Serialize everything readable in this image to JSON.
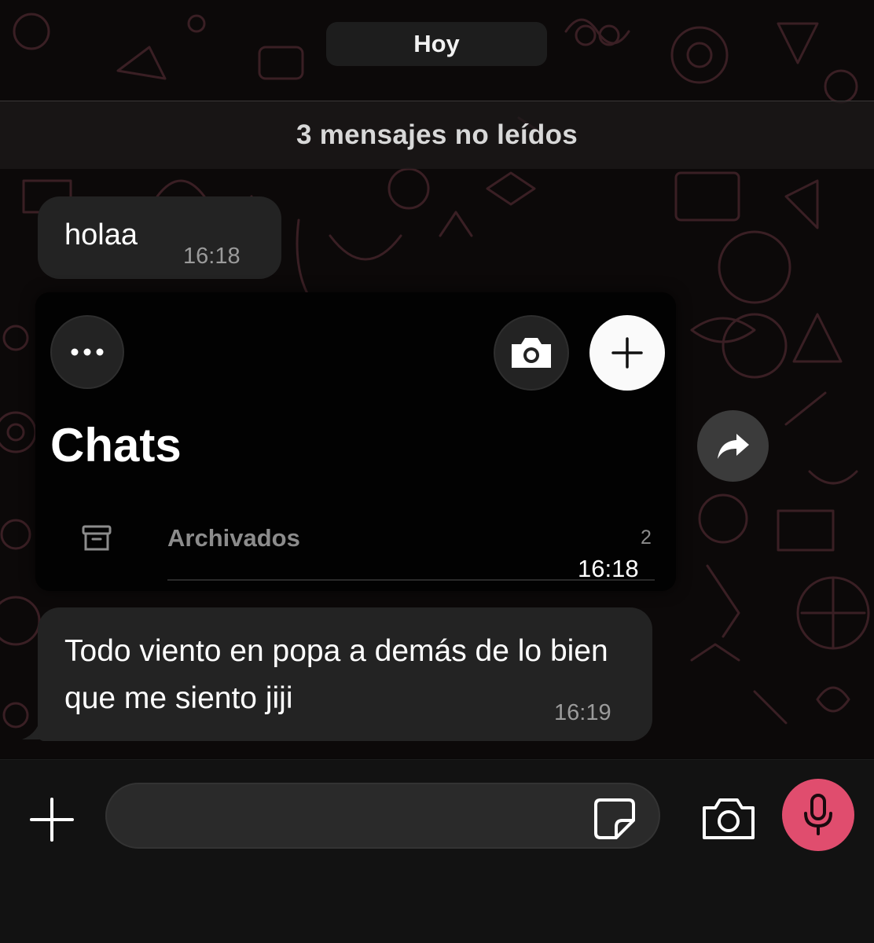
{
  "conversation": {
    "date_pill": "Hoy",
    "unread_banner": "3 mensajes no leídos",
    "messages": [
      {
        "text": "holaa",
        "time": "16:18"
      },
      {
        "text": "Todo viento en popa a demás de lo bien que me siento jiji",
        "time": "16:19"
      }
    ]
  },
  "shared_screenshot": {
    "title": "Chats",
    "archived_label": "Archivados",
    "archived_count": "2",
    "time": "16:18",
    "icons": [
      "more-icon",
      "camera-icon",
      "plus-icon",
      "archive-icon"
    ]
  },
  "actions": {
    "forward_icon": "forward-icon"
  },
  "input_bar": {
    "placeholder": "",
    "value": "",
    "icons": [
      "plus-icon",
      "sticker-icon",
      "camera-icon",
      "microphone-icon"
    ]
  },
  "colors": {
    "background": "#0a0808",
    "bubble": "#232323",
    "mic_accent": "#e04d6e",
    "timestamp": "#9b9b9b",
    "wallpaper_doodle": "#3a1f24"
  }
}
